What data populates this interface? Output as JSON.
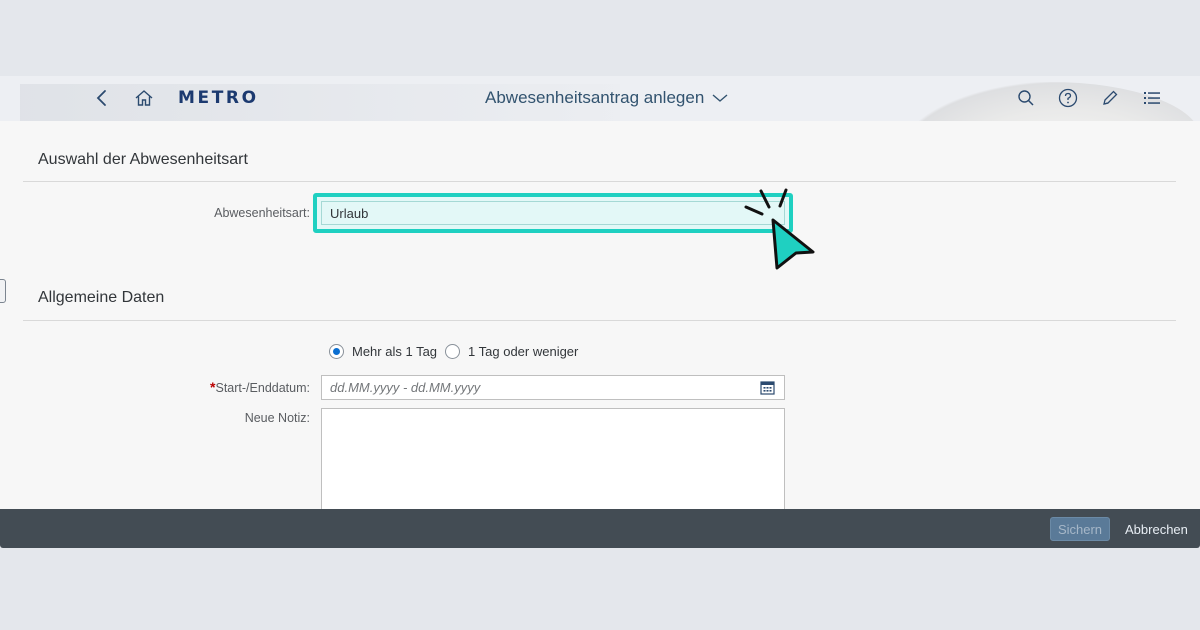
{
  "shell": {
    "logo": "METRO",
    "title": "Abwesenheitsantrag anlegen",
    "icons": {
      "back": "back-icon",
      "home": "home-icon",
      "title_dropdown": "chevron-down-icon",
      "search": "search-icon",
      "help": "help-icon",
      "edit": "pencil-icon",
      "menu": "list-menu-icon"
    }
  },
  "section1": {
    "title": "Auswahl der Abwesenheitsart",
    "absence_type_label": "Abwesenheitsart:",
    "absence_type_value": "Urlaub"
  },
  "section2": {
    "title": "Allgemeine Daten",
    "radio_options": [
      {
        "label": "Mehr als 1 Tag",
        "selected": true
      },
      {
        "label": "1 Tag oder weniger",
        "selected": false
      }
    ],
    "required_marker": "*",
    "date_label": "Start-/Enddatum:",
    "date_placeholder": "dd.MM.yyyy - dd.MM.yyyy",
    "note_label": "Neue Notiz:",
    "note_value": ""
  },
  "footer": {
    "save_label": "Sichern",
    "cancel_label": "Abbrechen"
  },
  "colors": {
    "highlight": "#1fd0c1",
    "brand_blue": "#1c3a70",
    "footer_bg": "#434c54"
  }
}
